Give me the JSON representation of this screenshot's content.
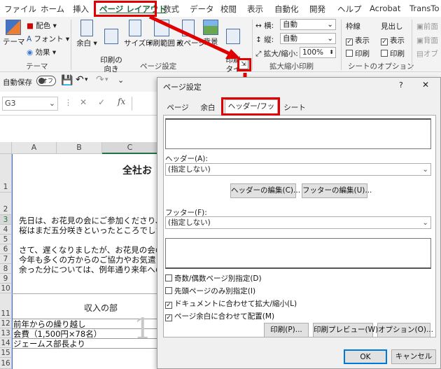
{
  "ribbon_tabs": [
    "ファイル",
    "ホーム",
    "挿入",
    "ページ レイアウト",
    "数式",
    "データ",
    "校閲",
    "表示",
    "自動化",
    "開発",
    "ヘルプ",
    "Acrobat",
    "TransTo"
  ],
  "theme": {
    "theme_label": "テーマ",
    "colors": "配色",
    "fonts": "フォント",
    "effects": "効果",
    "group": "テーマ"
  },
  "page_setup": {
    "margins": "余白",
    "orientation": "印刷の\n向き",
    "size": "サイズ",
    "print_area": "印刷範囲",
    "breaks": "改ページ",
    "background": "背景",
    "print_titles": "印刷\nタイトル",
    "group": "ページ設定"
  },
  "scale": {
    "width_label": "横:",
    "width_value": "自動",
    "height_label": "縦:",
    "height_value": "自動",
    "scale_label": "拡大/縮小:",
    "scale_value": "100%",
    "group": "拡大縮小印刷"
  },
  "sheet_options": {
    "gridlines": "枠線",
    "headings": "見出し",
    "view": "表示",
    "print": "印刷",
    "group": "シートのオプション"
  },
  "arrange": {
    "forward": "前面",
    "backward": "背面",
    "selection": "オブ"
  },
  "qat": {
    "autosave": "自動保存",
    "autosave_state": "オフ"
  },
  "formula_bar": {
    "name_box": "G3",
    "fx": "fx"
  },
  "grid": {
    "columns": [
      "A",
      "B",
      "C"
    ],
    "rows": [
      "1",
      "2",
      "3",
      "4",
      "5",
      "6",
      "7",
      "8",
      "9",
      "10",
      "11",
      "12",
      "13",
      "14",
      "15",
      "16"
    ],
    "title": "全社お",
    "lines": [
      "先日は、お花見の会にご参加くださり、誠",
      "桜はまだ五分咲きといったところでしたが",
      "さて、遅くなりましたが、お花見の会の収",
      "今年も多くの方からのご協力やお気遣い",
      "余った分については、例年通り来年への"
    ],
    "income_header": "収入の部",
    "item1": "前年からの繰り越し",
    "item2": "会費（1,500円×78名）",
    "item3": "ジェームス部長より",
    "watermark": "1"
  },
  "dialog": {
    "title": "ページ設定",
    "help": "?",
    "close": "✕",
    "tabs": [
      "ページ",
      "余白",
      "ヘッダー/フッター",
      "シート"
    ],
    "header_label": "ヘッダー(A):",
    "header_value": "(指定しない)",
    "edit_header": "ヘッダーの編集(C)...",
    "edit_footer": "フッターの編集(U)...",
    "footer_label": "フッター(F):",
    "footer_value": "(指定しない)",
    "checkboxes": [
      {
        "label": "奇数/偶数ページ別指定(D)",
        "checked": false
      },
      {
        "label": "先頭ページのみ別指定(I)",
        "checked": false
      },
      {
        "label": "ドキュメントに合わせて拡大/縮小(L)",
        "checked": true
      },
      {
        "label": "ページ余白に合わせて配置(M)",
        "checked": true
      }
    ],
    "print": "印刷(P)...",
    "print_preview": "印刷プレビュー(W)",
    "options": "オプション(O)...",
    "ok": "OK",
    "cancel": "キャンセル"
  },
  "colors": {
    "highlight": "#e00000",
    "ribbon_bg": "#f3f3f3",
    "dialog_bg": "#f0f0f0",
    "accent": "#217346"
  }
}
